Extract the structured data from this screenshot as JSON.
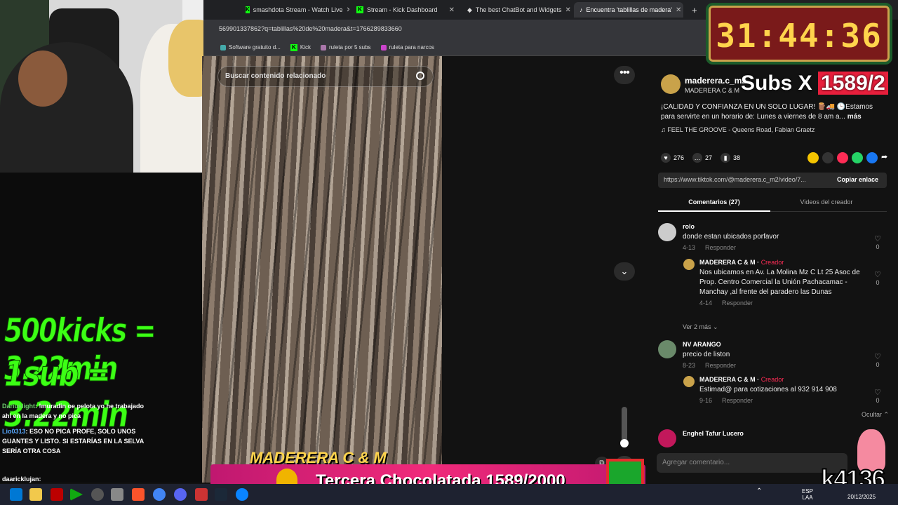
{
  "tabs": [
    {
      "label": "smashdota Stream - Watch Live"
    },
    {
      "label": "Stream - Kick Dashboard"
    },
    {
      "label": "The best ChatBot and Widgets"
    },
    {
      "label": "Encuentra 'tablillas de madera'"
    }
  ],
  "address": "569901337862?q=tablillas%20de%20madera&t=1766289833660",
  "bookmarks": [
    {
      "label": "Software gratuito d..."
    },
    {
      "label": "Kick"
    },
    {
      "label": "ruleta por 5 subs"
    },
    {
      "label": "ruleta para narcos"
    }
  ],
  "video": {
    "search_placeholder": "Buscar contenido relacionado"
  },
  "post": {
    "author": "maderera.c_m2",
    "author_name": "MADERERA C & M",
    "description": "¡CALIDAD Y CONFIANZA EN UN SOLO LUGAR! 🪵🚚 🕒Estamos para servirte en un horario de: Lunes a viernes de 8 am a...",
    "more": "más",
    "music": "FEEL THE GROOVE - Queens Road, Fabian Graetz",
    "likes": "276",
    "comments": "27",
    "saves": "38",
    "link": "https://www.tiktok.com/@maderera.c_m2/video/7...",
    "copy_link": "Copiar enlace",
    "tab_comments": "Comentarios (27)",
    "tab_creator": "Videos del creador",
    "add_comment": "Agregar comentario..."
  },
  "comments_list": [
    {
      "name": "rolo",
      "text": "donde estan ubicados porfavor",
      "date": "4-13",
      "reply": "Responder",
      "likes": "0"
    },
    {
      "name": "MADERERA C & M ·",
      "tag": "Creador",
      "text": "Nos ubicamos en Av. La Molina Mz C Lt 25 Asoc de Prop. Centro Comercial la Unión Pachacamac - Manchay ,al frente del paradero las Dunas",
      "date": "4-14",
      "reply": "Responder",
      "likes": "0"
    },
    {
      "name": "NV ARANGO",
      "text": "precio de liston",
      "date": "8-23",
      "reply": "Responder",
      "likes": "0"
    },
    {
      "name": "MADERERA C & M ·",
      "tag": "Creador",
      "text": "Estimad@ para cotizaciones al 932 914 908",
      "date": "9-16",
      "reply": "Responder",
      "likes": "0"
    },
    {
      "name": "Enghel Tafur Lucero",
      "text": "",
      "date": "",
      "reply": "",
      "likes": ""
    }
  ],
  "see_more": "Ver 2 más",
  "hide": "Ocultar",
  "overlay": {
    "timer": "31:44:36",
    "subs_label": "Subs X",
    "subs_count": "1589/2",
    "kicks_rate": "500kicks = 3.22min",
    "sub_rate": "1sub = 3.22min",
    "brand": "MADERERA C & M",
    "banner": "Tercera Chocolatada 1589/2000",
    "channel": "k4136"
  },
  "chat": [
    {
      "user": "Dariuslight",
      "color": "#6fd16f",
      "text": ": !muradin oe pelota yo he trabajado ahi en la madera y no pica"
    },
    {
      "user": "Lio0313",
      "color": "#58a8ff",
      "text": ": ESO NO PICA PROFE, SOLO UNOS GUANTES Y LISTO. SI ESTARÍAS EN LA SELVA SERÍA OTRA COSA"
    },
    {
      "user": "daaricklujan",
      "color": "#ffffff",
      "text": ":"
    }
  ],
  "tray": {
    "lang1": "ESP",
    "lang2": "LAA",
    "date": "20/12/2025"
  }
}
